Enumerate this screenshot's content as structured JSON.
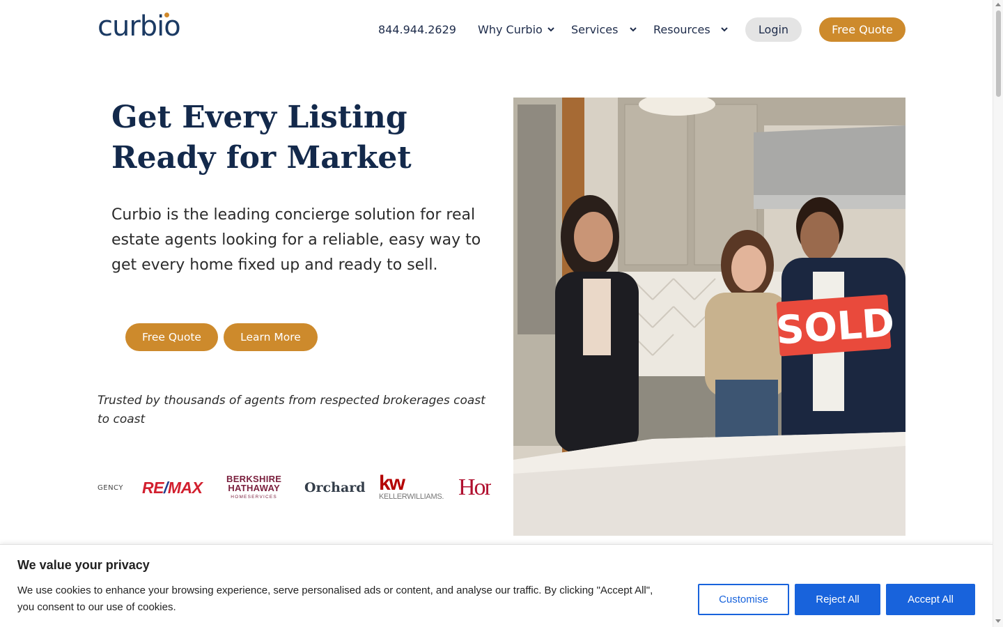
{
  "brand": {
    "logo_text": "curbio",
    "accent": "#cd8a2c",
    "navy": "#13294b"
  },
  "nav": {
    "phone": "844.944.2629",
    "why": "Why Curbio",
    "services": "Services",
    "resources": "Resources",
    "login": "Login",
    "free_quote": "Free Quote"
  },
  "hero": {
    "title": "Get Every Listing Ready for Market",
    "description": "Curbio is the leading concierge solution for real estate agents looking for a reliable, easy way to get every home fixed up and ready to sell.",
    "cta_primary": "Free Quote",
    "cta_secondary": "Learn More",
    "trusted": "Trusted by thousands of agents from respected brokerages coast to coast",
    "image_sign": "SOLD"
  },
  "brokerages": {
    "agency": "GENCY",
    "remax_a": "RE",
    "remax_slash": "/",
    "remax_b": "MAX",
    "bh_line1": "BERKSHIRE",
    "bh_line2": "HATHAWAY",
    "bh_line3": "HOMESERVICES",
    "orchard": "Orchard",
    "kw_logo": "kw",
    "kw_name": "KELLERWILLIAMS.",
    "homes": "HomeS"
  },
  "cookie": {
    "title": "We value your privacy",
    "text": "We use cookies to enhance your browsing experience, serve personalised ads or content, and analyse our traffic. By clicking \"Accept All\", you consent to our use of cookies.",
    "customise": "Customise",
    "reject": "Reject All",
    "accept": "Accept All",
    "button_color": "#1863dc"
  }
}
